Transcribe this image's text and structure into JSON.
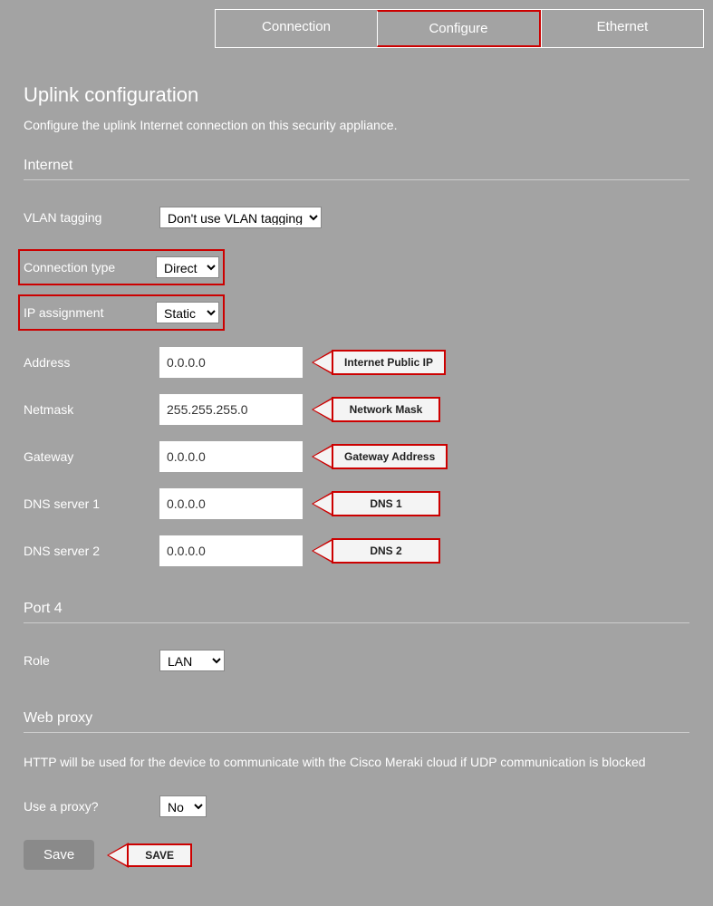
{
  "tabs": {
    "connection": "Connection",
    "configure": "Configure",
    "ethernet": "Ethernet"
  },
  "page": {
    "title": "Uplink configuration",
    "subtitle": "Configure the uplink Internet connection on this security appliance."
  },
  "internet": {
    "heading": "Internet",
    "vlan_label": "VLAN tagging",
    "vlan_value": "Don't use VLAN tagging",
    "conn_type_label": "Connection type",
    "conn_type_value": "Direct",
    "ip_assign_label": "IP assignment",
    "ip_assign_value": "Static",
    "address_label": "Address",
    "address_value": "0.0.0.0",
    "address_callout": "Internet Public IP",
    "netmask_label": "Netmask",
    "netmask_value": "255.255.255.0",
    "netmask_callout": "Network Mask",
    "gateway_label": "Gateway",
    "gateway_value": "0.0.0.0",
    "gateway_callout": "Gateway Address",
    "dns1_label": "DNS server 1",
    "dns1_value": "0.0.0.0",
    "dns1_callout": "DNS 1",
    "dns2_label": "DNS server 2",
    "dns2_value": "0.0.0.0",
    "dns2_callout": "DNS 2"
  },
  "port4": {
    "heading": "Port 4",
    "role_label": "Role",
    "role_value": "LAN"
  },
  "proxy": {
    "heading": "Web proxy",
    "note": "HTTP will be used for the device to communicate with the Cisco Meraki cloud if UDP communication is blocked",
    "use_label": "Use a proxy?",
    "use_value": "No"
  },
  "save": {
    "button": "Save",
    "callout": "SAVE"
  }
}
